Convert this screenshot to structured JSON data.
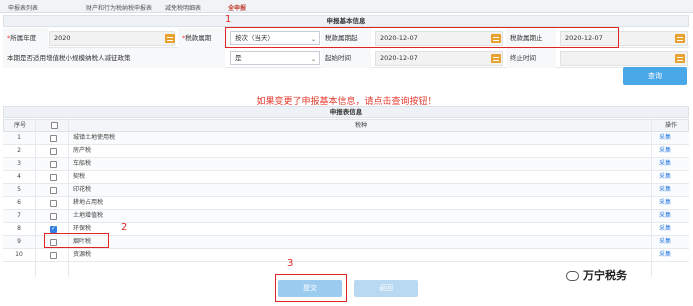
{
  "tabs": [
    "申报表列表",
    "财产和行为税纳税申报表",
    "减免税明细表",
    "全申报"
  ],
  "info": {
    "section_title": "申报基本信息",
    "year_label": "所属年度",
    "year_required": "*",
    "year_value": "2020",
    "period_label": "税款属期",
    "period_required": "*",
    "period_value": "按次（当天）",
    "start_label": "税款属期起",
    "start_value": "2020-12-07",
    "end_label": "税款属期止",
    "end_value": "2020-12-07",
    "policy_label": "本期是否适用增值税小规模纳税人减征政策",
    "policy_value": "是",
    "begin_label": "起始时间",
    "begin_value": "2020-12-07",
    "finish_label": "终止时间",
    "finish_value": "",
    "query_label": "查询"
  },
  "hint": "如果变更了申报基本信息，请点击查询按钮！",
  "table": {
    "section_title": "申报表信息",
    "headers": {
      "no": "序号",
      "name": "税种",
      "op": "操作"
    },
    "rows": [
      {
        "no": "1",
        "name": "城镇土地使用税",
        "op": "采集",
        "checked": false
      },
      {
        "no": "2",
        "name": "房产税",
        "op": "采集",
        "checked": false
      },
      {
        "no": "3",
        "name": "车船税",
        "op": "采集",
        "checked": false
      },
      {
        "no": "4",
        "name": "契税",
        "op": "采集",
        "checked": false
      },
      {
        "no": "5",
        "name": "印花税",
        "op": "采集",
        "checked": false
      },
      {
        "no": "6",
        "name": "耕地占用税",
        "op": "采集",
        "checked": false
      },
      {
        "no": "7",
        "name": "土地增值税",
        "op": "采集",
        "checked": false
      },
      {
        "no": "8",
        "name": "环保税",
        "op": "采集",
        "checked": true
      },
      {
        "no": "9",
        "name": "烟叶税",
        "op": "采集",
        "checked": false
      },
      {
        "no": "10",
        "name": "资源税",
        "op": "采集",
        "checked": false
      }
    ]
  },
  "buttons": {
    "submit": "提交",
    "back": "返回"
  },
  "annotations": {
    "one": "1",
    "two": "2",
    "three": "3"
  },
  "watermark": "万宁税务",
  "colors": {
    "accent": "#4aa8e8",
    "annotation": "#e02424",
    "calendar": "#e8a12c"
  }
}
